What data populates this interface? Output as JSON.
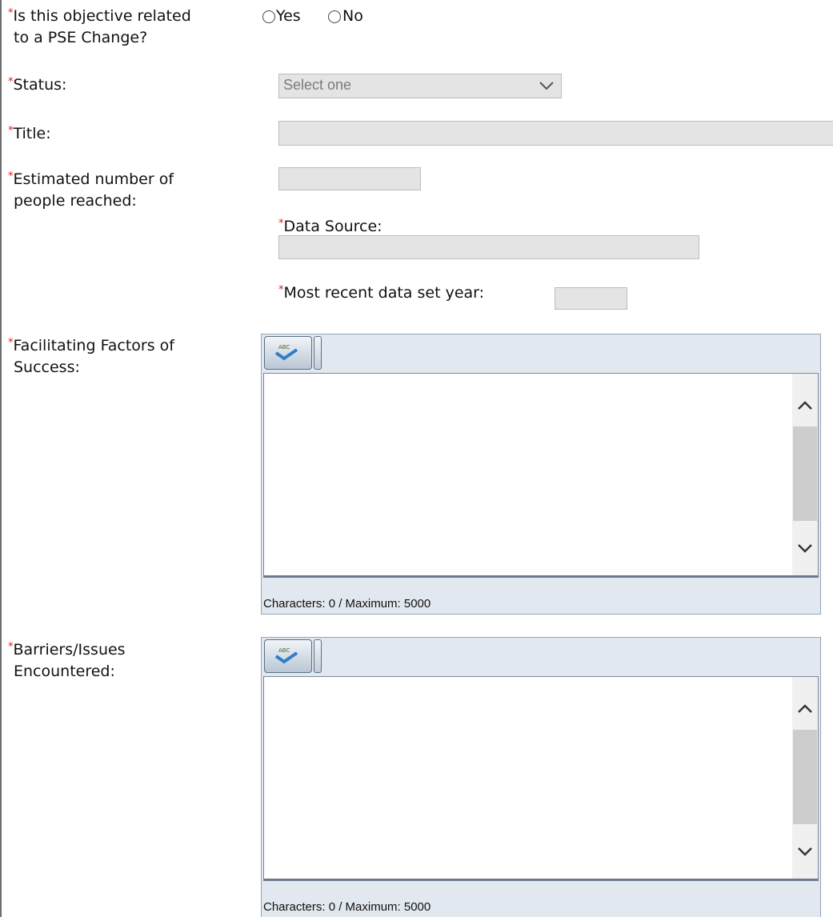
{
  "pse_question": {
    "label_line1": "Is this objective related",
    "label_line2": "to a PSE Change?",
    "options": [
      "Yes",
      "No"
    ]
  },
  "status": {
    "label": "Status:",
    "placeholder": "Select one"
  },
  "title": {
    "label": "Title:",
    "value": ""
  },
  "estimated": {
    "label_line1": "Estimated number of",
    "label_line2": "people reached:",
    "value": ""
  },
  "data_source": {
    "label": "Data Source:",
    "value": ""
  },
  "data_year": {
    "label": "Most recent data set year:",
    "value": ""
  },
  "facilitating": {
    "label_line1": "Facilitating Factors of",
    "label_line2": "Success:",
    "counter": "Characters: 0 / Maximum: 5000"
  },
  "barriers": {
    "label_line1": "Barriers/Issues",
    "label_line2": "Encountered:",
    "counter": "Characters: 0 / Maximum: 5000"
  },
  "required_marker": "*",
  "colors": {
    "required": "#e0191a",
    "field_bg": "#e4e4e4",
    "editor_bg": "#e2e8ef"
  },
  "icons": {
    "spellcheck": "spellcheck-icon",
    "chevron": "chevron-down-icon"
  }
}
